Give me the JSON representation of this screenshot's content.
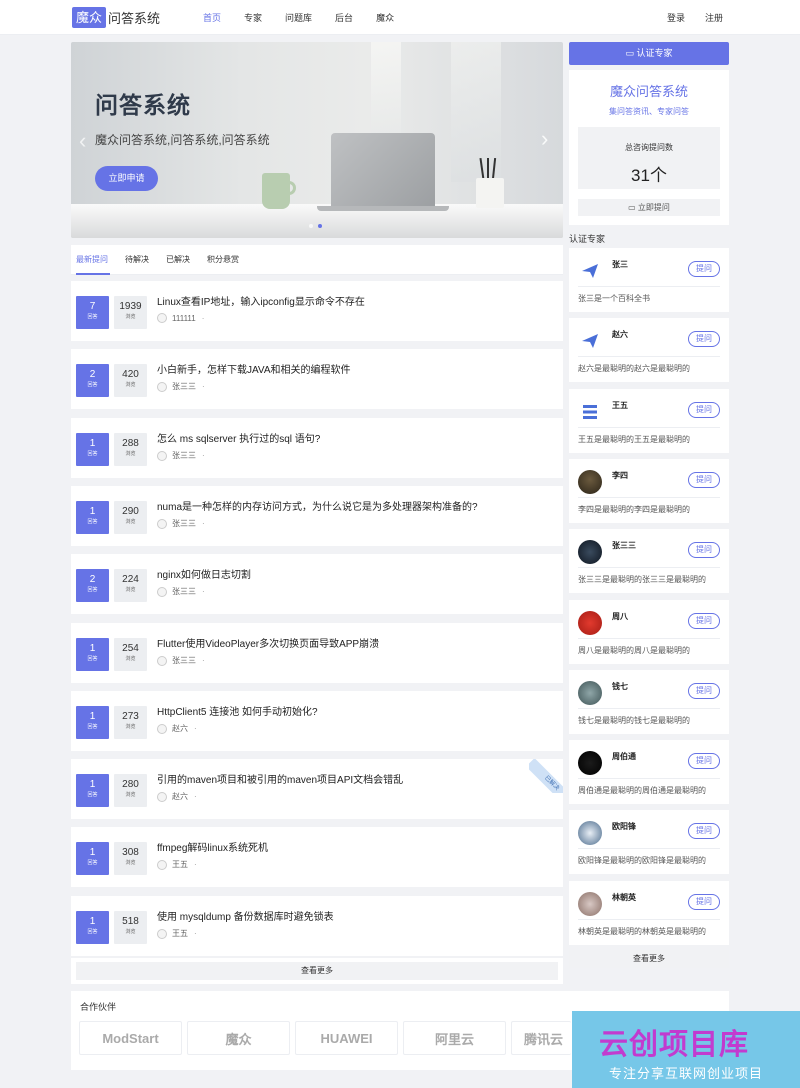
{
  "header": {
    "logo_box": "魔众",
    "logo_text": "问答系统",
    "nav": [
      "首页",
      "专家",
      "问题库",
      "后台",
      "魔众"
    ],
    "login": "登录",
    "register": "注册"
  },
  "banner": {
    "title": "问答系统",
    "subtitle": "魔众问答系统,问答系统,问答系统",
    "button": "立即申请"
  },
  "tabs": [
    "最新提问",
    "待解决",
    "已解决",
    "积分悬赏"
  ],
  "labels": {
    "answers": "回答",
    "views": "浏览",
    "solved": "已解决",
    "more": "查看更多"
  },
  "questions": [
    {
      "answers": "7",
      "views": "1939",
      "title": "Linux查看IP地址，输入ipconfig显示命令不存在",
      "user": "111111"
    },
    {
      "answers": "2",
      "views": "420",
      "title": "小白新手，怎样下载JAVA和相关的编程软件",
      "user": "张三三"
    },
    {
      "answers": "1",
      "views": "288",
      "title": "怎么 ms sqlserver 执行过的sql 语句?",
      "user": "张三三"
    },
    {
      "answers": "1",
      "views": "290",
      "title": "numa是一种怎样的内存访问方式，为什么说它是为多处理器架构准备的?",
      "user": "张三三"
    },
    {
      "answers": "2",
      "views": "224",
      "title": "nginx如何做日志切割",
      "user": "张三三"
    },
    {
      "answers": "1",
      "views": "254",
      "title": "Flutter使用VideoPlayer多次切换页面导致APP崩溃",
      "user": "张三三"
    },
    {
      "answers": "1",
      "views": "273",
      "title": "HttpClient5 连接池 如何手动初始化?",
      "user": "赵六"
    },
    {
      "answers": "1",
      "views": "280",
      "title": "引用的maven项目和被引用的maven项目API文档会错乱",
      "user": "赵六"
    },
    {
      "answers": "1",
      "views": "308",
      "title": "ffmpeg解码linux系统死机",
      "user": "王五"
    },
    {
      "answers": "1",
      "views": "518",
      "title": "使用 mysqldump 备份数据库时避免锁表",
      "user": "王五"
    }
  ],
  "sidebar": {
    "cert_button": "认证专家",
    "stat_title": "魔众问答系统",
    "stat_sub": "集问答资讯、专家问答",
    "stat_label": "总咨询提问数",
    "stat_num": "31个",
    "ask_button": "立即提问",
    "experts_head": "认证专家",
    "ask_label": "提问",
    "experts": [
      {
        "name": "张三",
        "desc": "张三是一个百科全书"
      },
      {
        "name": "赵六",
        "desc": "赵六是最聪明的赵六是最聪明的"
      },
      {
        "name": "王五",
        "desc": "王五是最聪明的王五是最聪明的"
      },
      {
        "name": "李四",
        "desc": "李四是最聪明的李四是最聪明的"
      },
      {
        "name": "张三三",
        "desc": "张三三是最聪明的张三三是最聪明的"
      },
      {
        "name": "周八",
        "desc": "周八是最聪明的周八是最聪明的"
      },
      {
        "name": "钱七",
        "desc": "钱七是最聪明的钱七是最聪明的"
      },
      {
        "name": "周伯通",
        "desc": "周伯通是最聪明的周伯通是最聪明的"
      },
      {
        "name": "欧阳锋",
        "desc": "欧阳锋是最聪明的欧阳锋是最聪明的"
      },
      {
        "name": "林朝英",
        "desc": "林朝英是最聪明的林朝英是最聪明的"
      }
    ]
  },
  "partners": {
    "title": "合作伙伴",
    "logos": [
      "ModStart",
      "魔众",
      "HUAWEI",
      "阿里云",
      "腾讯云"
    ]
  },
  "watermark": {
    "title": "云创项目库",
    "subtitle": "专注分享互联网创业项目"
  }
}
